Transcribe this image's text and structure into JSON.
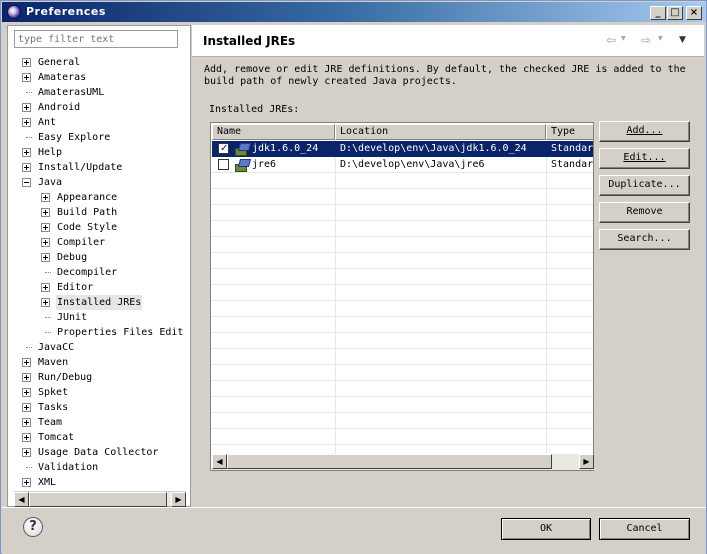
{
  "window": {
    "title": "Preferences",
    "minimize_glyph": "_",
    "maximize_glyph": "□",
    "close_glyph": "×"
  },
  "sidebar": {
    "filter_placeholder": "type filter text",
    "items": [
      {
        "label": "General",
        "level": 0,
        "expander": "plus"
      },
      {
        "label": "Amateras",
        "level": 0,
        "expander": "plus"
      },
      {
        "label": "AmaterasUML",
        "level": 0,
        "expander": "none"
      },
      {
        "label": "Android",
        "level": 0,
        "expander": "plus"
      },
      {
        "label": "Ant",
        "level": 0,
        "expander": "plus"
      },
      {
        "label": "Easy Explore",
        "level": 0,
        "expander": "none"
      },
      {
        "label": "Help",
        "level": 0,
        "expander": "plus"
      },
      {
        "label": "Install/Update",
        "level": 0,
        "expander": "plus"
      },
      {
        "label": "Java",
        "level": 0,
        "expander": "minus"
      },
      {
        "label": "Appearance",
        "level": 1,
        "expander": "plus"
      },
      {
        "label": "Build Path",
        "level": 1,
        "expander": "plus"
      },
      {
        "label": "Code Style",
        "level": 1,
        "expander": "plus"
      },
      {
        "label": "Compiler",
        "level": 1,
        "expander": "plus"
      },
      {
        "label": "Debug",
        "level": 1,
        "expander": "plus"
      },
      {
        "label": "Decompiler",
        "level": 1,
        "expander": "none"
      },
      {
        "label": "Editor",
        "level": 1,
        "expander": "plus"
      },
      {
        "label": "Installed JREs",
        "level": 1,
        "expander": "plus",
        "selected": true
      },
      {
        "label": "JUnit",
        "level": 1,
        "expander": "none"
      },
      {
        "label": "Properties Files Edit",
        "level": 1,
        "expander": "none"
      },
      {
        "label": "JavaCC",
        "level": 0,
        "expander": "none"
      },
      {
        "label": "Maven",
        "level": 0,
        "expander": "plus"
      },
      {
        "label": "Run/Debug",
        "level": 0,
        "expander": "plus"
      },
      {
        "label": "Spket",
        "level": 0,
        "expander": "plus"
      },
      {
        "label": "Tasks",
        "level": 0,
        "expander": "plus"
      },
      {
        "label": "Team",
        "level": 0,
        "expander": "plus"
      },
      {
        "label": "Tomcat",
        "level": 0,
        "expander": "plus"
      },
      {
        "label": "Usage Data Collector",
        "level": 0,
        "expander": "plus"
      },
      {
        "label": "Validation",
        "level": 0,
        "expander": "none"
      },
      {
        "label": "XML",
        "level": 0,
        "expander": "plus"
      }
    ],
    "scroll_left": "◀",
    "scroll_right": "▶"
  },
  "page": {
    "title": "Installed JREs",
    "nav_back": "⇦",
    "nav_forward": "⇨",
    "menu_glyph": "▼",
    "description_line1": "Add, remove or edit JRE definitions. By default, the checked JRE is added to the",
    "description_line2": "build path of newly created Java projects.",
    "table_label": "Installed JREs:",
    "columns": [
      "Name",
      "Location",
      "Type"
    ],
    "rows": [
      {
        "checked": true,
        "name": "jdk1.6.0_24",
        "location": "D:\\develop\\env\\Java\\jdk1.6.0_24",
        "type": "Standar",
        "selected": true
      },
      {
        "checked": false,
        "name": "jre6",
        "location": "D:\\develop\\env\\Java\\jre6",
        "type": "Standar",
        "selected": false
      }
    ],
    "buttons": {
      "add": "Add...",
      "edit": "Edit...",
      "duplicate": "Duplicate...",
      "remove": "Remove",
      "search": "Search..."
    }
  },
  "footer": {
    "help_glyph": "?",
    "ok": "OK",
    "cancel": "Cancel"
  },
  "colors": {
    "selection": "#0a246a",
    "title_gradient_start": "#0a246a",
    "face": "#d4d0c8"
  }
}
